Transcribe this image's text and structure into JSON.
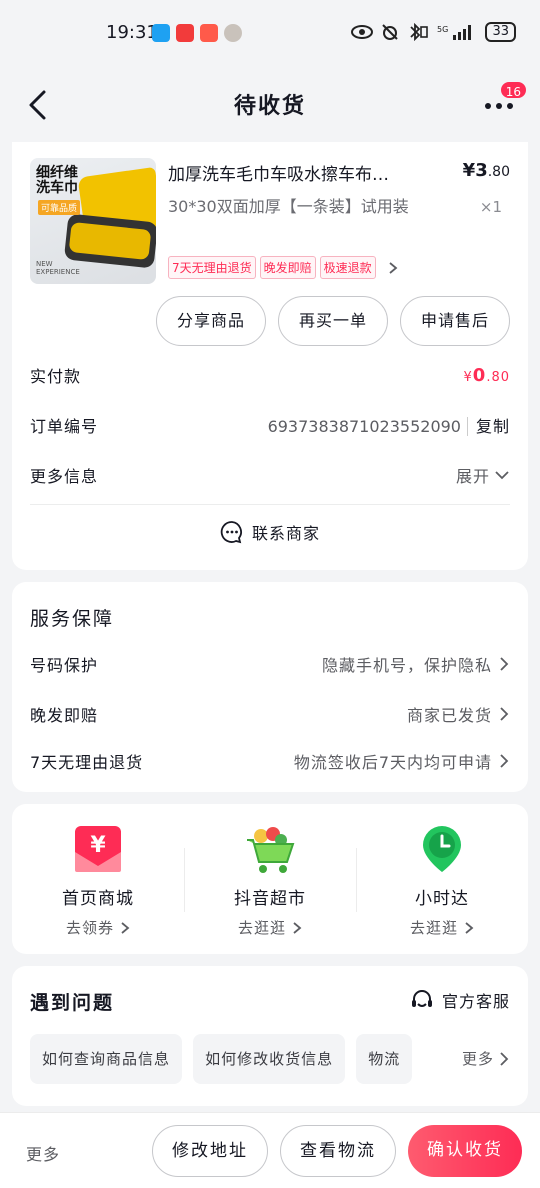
{
  "status_bar": {
    "time": "19:31",
    "battery": "33"
  },
  "header": {
    "title": "待收货",
    "badge_count": "16"
  },
  "product": {
    "thumb_label": "细纤维\n洗车巾",
    "thumb_tag": "可靠品质",
    "thumb_new": "NEW\nEXPERIENCE",
    "title": "加厚洗车毛巾车吸水擦车布…",
    "spec": "30*30双面加厚【一条装】试用装",
    "price_symbol": "¥",
    "price_int": "3",
    "price_dec": ".80",
    "qty": "×1",
    "tags": [
      "7天无理由退货",
      "晚发即赔",
      "极速退款"
    ]
  },
  "actions": {
    "share": "分享商品",
    "rebuy": "再买一单",
    "aftersale": "申请售后"
  },
  "order": {
    "paid_label": "实付款",
    "paid_symbol": "¥",
    "paid_int": "0",
    "paid_dec": ".80",
    "order_no_label": "订单编号",
    "order_no": "6937383871023552090",
    "copy_label": "复制",
    "more_info_label": "更多信息",
    "expand_label": "展开",
    "contact_label": "联系商家"
  },
  "service": {
    "title": "服务保障",
    "rows": [
      {
        "label": "号码保护",
        "desc": "隐藏手机号，保护隐私"
      },
      {
        "label": "晚发即赔",
        "desc": "商家已发货"
      },
      {
        "label": "7天无理由退货",
        "desc": "物流签收后7天内均可申请"
      }
    ]
  },
  "shortcuts": [
    {
      "name": "首页商城",
      "sub": "去领券",
      "icon": "yuan-coupon-icon"
    },
    {
      "name": "抖音超市",
      "sub": "去逛逛",
      "icon": "shopping-cart-icon"
    },
    {
      "name": "小时达",
      "sub": "去逛逛",
      "icon": "clock-pin-icon"
    }
  ],
  "problems": {
    "title": "遇到问题",
    "cs_label": "官方客服",
    "faqs": [
      "如何查询商品信息",
      "如何修改收货信息",
      "物流"
    ],
    "more_label": "更多"
  },
  "bottom": {
    "more_label": "更多",
    "modify_address": "修改地址",
    "view_logistics": "查看物流",
    "confirm_receipt": "确认收货"
  },
  "colors": {
    "accent": "#fe2c55",
    "background": "#f3f4f6"
  }
}
